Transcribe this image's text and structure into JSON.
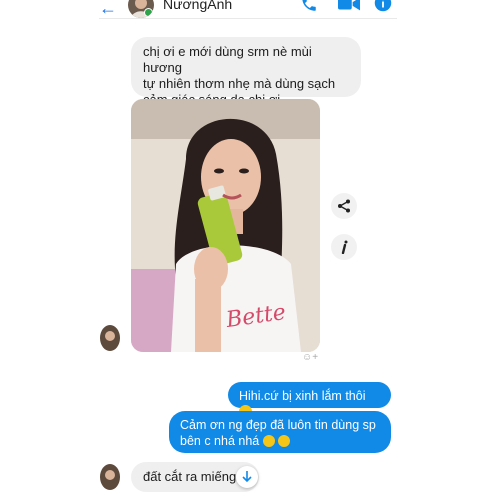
{
  "header": {
    "contact_name": "NươngAnh"
  },
  "messages": {
    "incoming_1": [
      "chị ơi e mới dùng srm nè mùi hương",
      "tự nhiên thơm nhẹ mà dùng sạch",
      "cảm giác sáng da chị ơi"
    ],
    "outgoing_1": "Hihi.cứ bị xinh lắm thôi",
    "outgoing_2": [
      "Cảm ơn ng đẹp đã luôn tin dùng sp",
      "bên c nhá nhá"
    ],
    "incoming_2": "đất cắt ra miếng"
  },
  "photo": {
    "shirt_text": "Bette"
  },
  "colors": {
    "accent": "#1189e6",
    "incoming_bg": "#efefef"
  },
  "icons": [
    "back-arrow-icon",
    "phone-icon",
    "video-camera-icon",
    "info-icon",
    "share-icon",
    "edit-icon",
    "scroll-down-icon"
  ]
}
